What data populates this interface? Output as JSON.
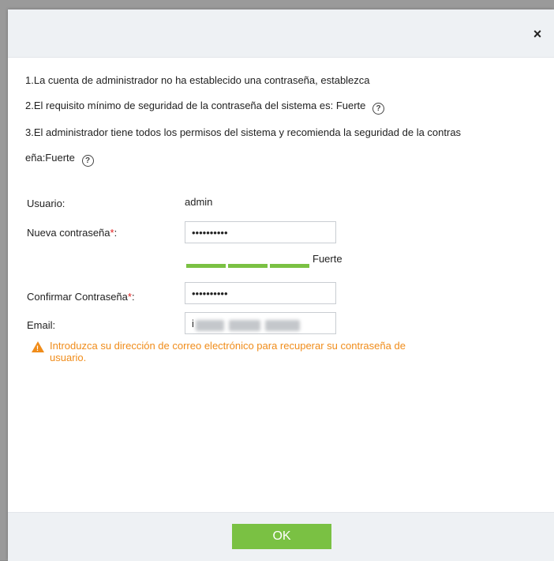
{
  "dialog": {
    "close_symbol": "×",
    "messages": [
      "1.La cuenta de administrador no ha establecido una contraseña, establezca",
      "2.El requisito mínimo de seguridad de la contraseña del sistema es: Fuerte",
      "3.El administrador tiene todos los permisos del sistema y recomienda la seguridad de la contras",
      "eña:Fuerte"
    ],
    "help_symbol": "?"
  },
  "form": {
    "user_label": "Usuario:",
    "user_value": "admin",
    "new_password_label": "Nueva contraseña",
    "new_password_value": "••••••••••",
    "strength_label": "Fuerte",
    "strength_level": "3/3",
    "confirm_password_label": "Confirmar Contraseña",
    "confirm_password_value": "••••••••••",
    "required_mark": "*",
    "colon": ":",
    "email_label": "Email:",
    "email_visible_start": "i",
    "warning_icon_mark": "!",
    "warning_text": "Introduzca su dirección de correo electrónico para recuperar su contraseña de usuario."
  },
  "footer": {
    "ok_label": "OK"
  },
  "colors": {
    "accent_green": "#7ac143",
    "warning_orange": "#f08c1a",
    "required_red": "#e02020",
    "header_bg": "#eef1f4"
  }
}
